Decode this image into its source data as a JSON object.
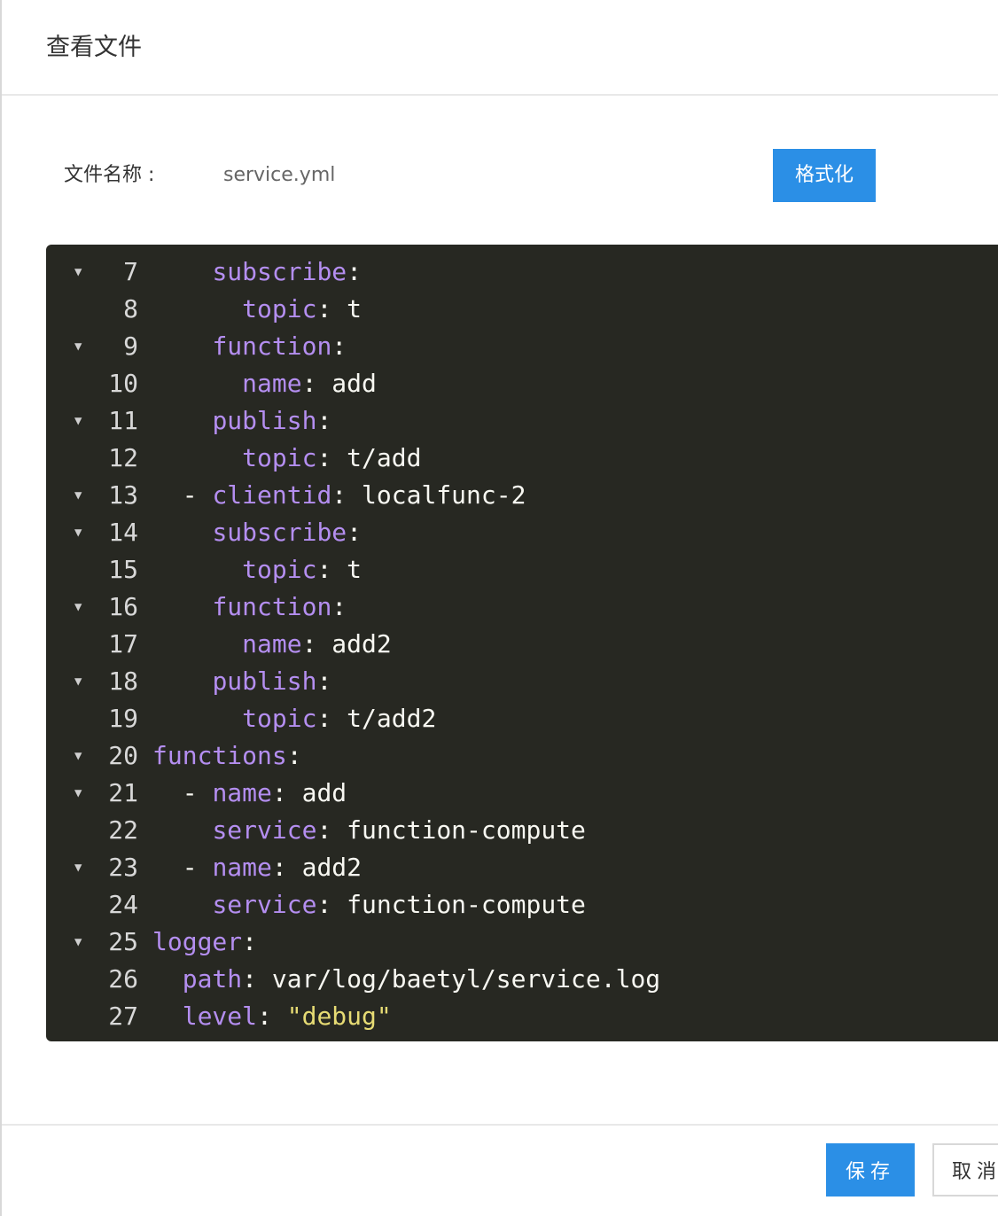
{
  "dialog": {
    "title": "查看文件"
  },
  "file": {
    "name_label": "文件名称 :",
    "name_value": "service.yml",
    "format_label": "格式化"
  },
  "editor": {
    "theme": {
      "background": "#272822",
      "key_color": "#b48ef0",
      "string_color": "#e6db74",
      "text_color": "#f8f8f2"
    },
    "lines": [
      {
        "num": "7",
        "fold": true,
        "tokens": [
          {
            "t": "    "
          },
          {
            "k": "subscribe"
          },
          {
            "t": ":"
          }
        ]
      },
      {
        "num": "8",
        "fold": false,
        "tokens": [
          {
            "t": "      "
          },
          {
            "k": "topic"
          },
          {
            "t": ": t"
          }
        ]
      },
      {
        "num": "9",
        "fold": true,
        "tokens": [
          {
            "t": "    "
          },
          {
            "k": "function"
          },
          {
            "t": ":"
          }
        ]
      },
      {
        "num": "10",
        "fold": false,
        "tokens": [
          {
            "t": "      "
          },
          {
            "k": "name"
          },
          {
            "t": ": add"
          }
        ]
      },
      {
        "num": "11",
        "fold": true,
        "tokens": [
          {
            "t": "    "
          },
          {
            "k": "publish"
          },
          {
            "t": ":"
          }
        ]
      },
      {
        "num": "12",
        "fold": false,
        "tokens": [
          {
            "t": "      "
          },
          {
            "k": "topic"
          },
          {
            "t": ": t/add"
          }
        ]
      },
      {
        "num": "13",
        "fold": true,
        "tokens": [
          {
            "t": "  - "
          },
          {
            "k": "clientid"
          },
          {
            "t": ": localfunc-2"
          }
        ]
      },
      {
        "num": "14",
        "fold": true,
        "tokens": [
          {
            "t": "    "
          },
          {
            "k": "subscribe"
          },
          {
            "t": ":"
          }
        ]
      },
      {
        "num": "15",
        "fold": false,
        "tokens": [
          {
            "t": "      "
          },
          {
            "k": "topic"
          },
          {
            "t": ": t"
          }
        ]
      },
      {
        "num": "16",
        "fold": true,
        "tokens": [
          {
            "t": "    "
          },
          {
            "k": "function"
          },
          {
            "t": ":"
          }
        ]
      },
      {
        "num": "17",
        "fold": false,
        "tokens": [
          {
            "t": "      "
          },
          {
            "k": "name"
          },
          {
            "t": ": add2"
          }
        ]
      },
      {
        "num": "18",
        "fold": true,
        "tokens": [
          {
            "t": "    "
          },
          {
            "k": "publish"
          },
          {
            "t": ":"
          }
        ]
      },
      {
        "num": "19",
        "fold": false,
        "tokens": [
          {
            "t": "      "
          },
          {
            "k": "topic"
          },
          {
            "t": ": t/add2"
          }
        ]
      },
      {
        "num": "20",
        "fold": true,
        "tokens": [
          {
            "k": "functions"
          },
          {
            "t": ":"
          }
        ]
      },
      {
        "num": "21",
        "fold": true,
        "tokens": [
          {
            "t": "  - "
          },
          {
            "k": "name"
          },
          {
            "t": ": add"
          }
        ]
      },
      {
        "num": "22",
        "fold": false,
        "tokens": [
          {
            "t": "    "
          },
          {
            "k": "service"
          },
          {
            "t": ": function-compute"
          }
        ]
      },
      {
        "num": "23",
        "fold": true,
        "tokens": [
          {
            "t": "  - "
          },
          {
            "k": "name"
          },
          {
            "t": ": add2"
          }
        ]
      },
      {
        "num": "24",
        "fold": false,
        "tokens": [
          {
            "t": "    "
          },
          {
            "k": "service"
          },
          {
            "t": ": function-compute"
          }
        ]
      },
      {
        "num": "25",
        "fold": true,
        "tokens": [
          {
            "k": "logger"
          },
          {
            "t": ":"
          }
        ]
      },
      {
        "num": "26",
        "fold": false,
        "tokens": [
          {
            "t": "  "
          },
          {
            "k": "path"
          },
          {
            "t": ": var/log/baetyl/service.log"
          }
        ]
      },
      {
        "num": "27",
        "fold": false,
        "tokens": [
          {
            "t": "  "
          },
          {
            "k": "level"
          },
          {
            "t": ": "
          },
          {
            "s": "\"debug\""
          }
        ]
      }
    ]
  },
  "footer": {
    "save_label": "保存",
    "cancel_label": "取消"
  }
}
